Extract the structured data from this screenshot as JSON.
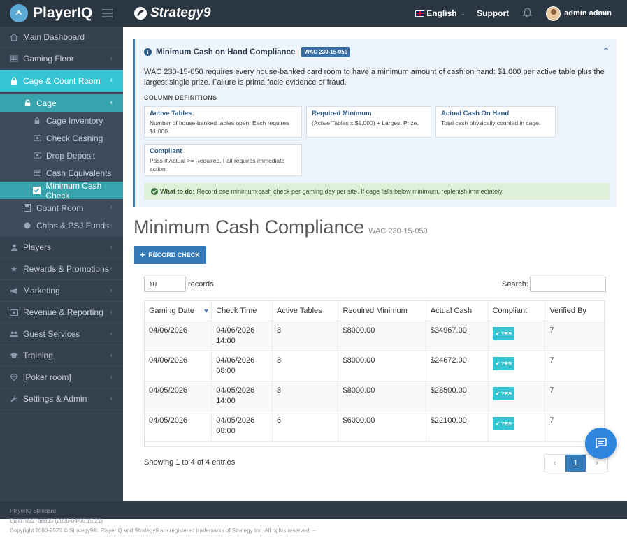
{
  "topbar": {
    "brand": "PlayerIQ",
    "partner": "Strategy9",
    "language": "English",
    "support": "Support",
    "user": "admin admin"
  },
  "sidebar": {
    "items": [
      {
        "label": "Main Dashboard",
        "icon": "home-icon"
      },
      {
        "label": "Gaming Floor",
        "icon": "grid-icon"
      },
      {
        "label": "Cage & Count Room",
        "icon": "lock-icon"
      },
      {
        "label": "Cage",
        "icon": "lock-icon"
      },
      {
        "label": "Cage Inventory",
        "icon": "lock-icon"
      },
      {
        "label": "Check Cashing",
        "icon": "money-icon"
      },
      {
        "label": "Drop Deposit",
        "icon": "money-icon"
      },
      {
        "label": "Cash Equivalents",
        "icon": "card-icon"
      },
      {
        "label": "Minimum Cash Check",
        "icon": "checkbox-icon"
      },
      {
        "label": "Count Room",
        "icon": "calculator-icon"
      },
      {
        "label": "Chips & PSJ Funds",
        "icon": "chip-icon"
      },
      {
        "label": "Players",
        "icon": "user-icon"
      },
      {
        "label": "Rewards & Promotions",
        "icon": "star-icon"
      },
      {
        "label": "Marketing",
        "icon": "bullhorn-icon"
      },
      {
        "label": "Revenue & Reporting",
        "icon": "money-icon"
      },
      {
        "label": "Guest Services",
        "icon": "users-icon"
      },
      {
        "label": "Training",
        "icon": "graduation-icon"
      },
      {
        "label": "[Poker room]",
        "icon": "diamond-icon"
      },
      {
        "label": "Settings & Admin",
        "icon": "wrench-icon"
      }
    ]
  },
  "info": {
    "title": "Minimum Cash on Hand Compliance",
    "badge": "WAC 230-15-050",
    "description": "WAC 230-15-050 requires every house-banked card room to have a minimum amount of cash on hand: $1,000 per active table plus the largest single prize. Failure is prima facie evidence of fraud.",
    "coldef_heading": "COLUMN DEFINITIONS",
    "definitions": [
      {
        "term": "Active Tables",
        "desc": "Number of house-banked tables open. Each requires $1,000."
      },
      {
        "term": "Required Minimum",
        "desc": "(Active Tables x $1,000) + Largest Prize."
      },
      {
        "term": "Actual Cash On Hand",
        "desc": "Total cash physically counted in cage."
      },
      {
        "term": "Compliant",
        "desc": "Pass if Actual >= Required. Fail requires immediate action."
      }
    ],
    "todo_label": "What to do:",
    "todo_text": "Record one minimum cash check per gaming day per site. If cage falls below minimum, replenish immediately."
  },
  "page": {
    "title": "Minimum Cash Compliance",
    "subtitle": "WAC 230-15-050",
    "record_button": "RECORD CHECK"
  },
  "table": {
    "length_value": "10",
    "length_label": "records",
    "search_label": "Search:",
    "columns": [
      "Gaming Date",
      "Check Time",
      "Active Tables",
      "Required Minimum",
      "Actual Cash",
      "Compliant",
      "Verified By"
    ],
    "rows": [
      {
        "date": "04/06/2026",
        "time": "04/06/2026 14:00",
        "tables": "8",
        "required": "$8000.00",
        "actual": "$34967.00",
        "compliant": "YES",
        "verified": "7"
      },
      {
        "date": "04/06/2026",
        "time": "04/06/2026 08:00",
        "tables": "8",
        "required": "$8000.00",
        "actual": "$24672.00",
        "compliant": "YES",
        "verified": "7"
      },
      {
        "date": "04/05/2026",
        "time": "04/05/2026 14:00",
        "tables": "8",
        "required": "$8000.00",
        "actual": "$28500.00",
        "compliant": "YES",
        "verified": "7"
      },
      {
        "date": "04/05/2026",
        "time": "04/05/2026 08:00",
        "tables": "6",
        "required": "$6000.00",
        "actual": "$22100.00",
        "compliant": "YES",
        "verified": "7"
      }
    ],
    "showing": "Showing 1 to 4 of 4 entries",
    "pager": {
      "prev": "‹",
      "current": "1",
      "next": "›"
    }
  },
  "footer": {
    "edition": "PlayerIQ Standard",
    "build": "Build: 0327deb35 (2026-04-06 15:21)",
    "copyright": "Copyright 2000-2026 © Strategy9®. PlayerIQ and Strategy9 are registered trademarks of Strategy Inc. All rights reserved. --"
  },
  "colors": {
    "accent": "#36c6d3",
    "primary": "#337ab7",
    "topbar": "#2b3643",
    "sidebar": "#364150"
  }
}
